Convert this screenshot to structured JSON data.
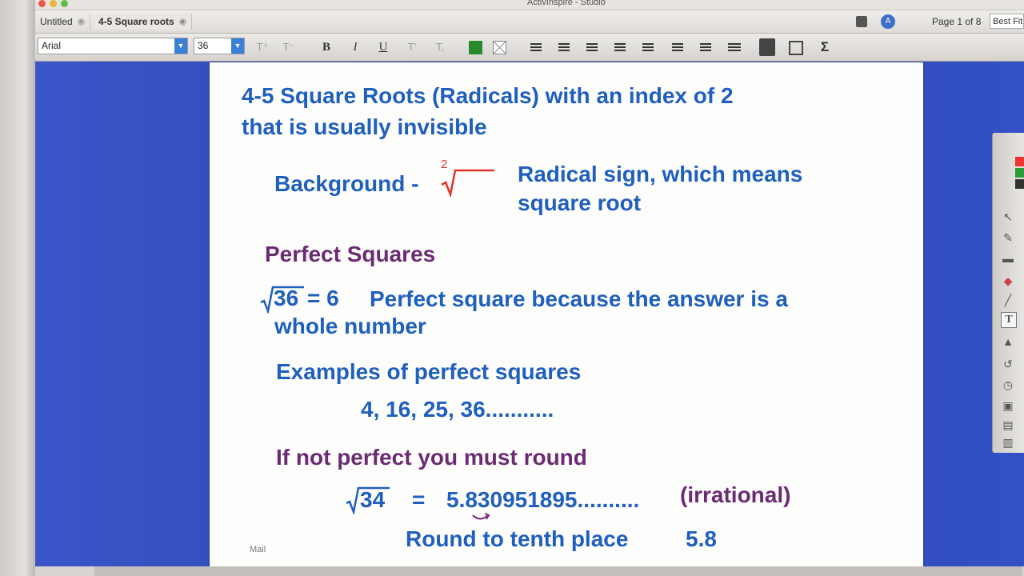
{
  "app": {
    "title": "ActivInspire - Studio"
  },
  "tabs": [
    {
      "label": "Untitled",
      "active": false
    },
    {
      "label": "4-5 Square roots",
      "active": true
    }
  ],
  "page_indicator": "Page 1 of 8",
  "zoom_select": "Best Fit",
  "format_toolbar": {
    "font": "Arial",
    "size": "36",
    "bold": "B",
    "italic": "I",
    "underline": "U",
    "sum_symbol": "Σ",
    "fill_color": "#2a8a2a"
  },
  "slide": {
    "title_line1": "4-5 Square Roots (Radicals) with an index of 2",
    "title_line2": "that is usually invisible",
    "background_label": "Background -",
    "radical_index": "2",
    "radical_desc_line1": "Radical sign, which means",
    "radical_desc_line2": "square root",
    "perfect_heading": "Perfect Squares",
    "example1_radicand": "36",
    "example1_result": "= 6",
    "example1_desc_line1": "Perfect square because the answer is a",
    "example1_desc_line2": "whole number",
    "examples_heading": "Examples of perfect squares",
    "examples_list": "4, 16, 25, 36...........",
    "round_heading": "If not perfect you must round",
    "example2_radicand": "34",
    "example2_equals": "=",
    "example2_value": "5.830951895..........",
    "irrational_label": "(irrational)",
    "round_tenth": "Round to tenth place",
    "rounded_value": "5.8"
  },
  "dock": {
    "mail_label": "Mail"
  },
  "colors": {
    "blue_text": "#1f5fbd",
    "purple_text": "#6b2b73",
    "radical_red": "#e0322a",
    "workspace_blue": "#3350c4"
  }
}
